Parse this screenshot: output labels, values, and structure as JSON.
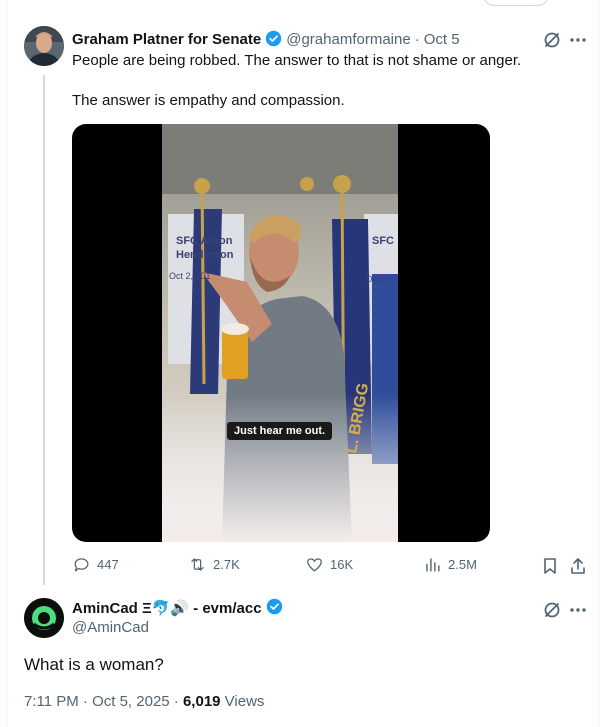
{
  "tweet": {
    "author_name": "Graham Platner for Senate",
    "handle": "@grahamformaine",
    "separator": "·",
    "date": "Oct 5",
    "line1": "People are being robbed. The answer to that is not shame or anger.",
    "line2": "The answer is empathy and compassion.",
    "video_caption": "Just hear me out.",
    "banner_left": {
      "line1": "SFC Aaron",
      "line2": "Henderson",
      "line3": "Oct 2, 201"
    },
    "banner_right": {
      "line1": "SFC",
      "line3": "Dece"
    },
    "flag_text": "L. BRIGG",
    "actions": {
      "replies": "447",
      "reposts": "2.7K",
      "likes": "16K",
      "views": "2.5M"
    }
  },
  "reply": {
    "author_name": "AminCad Ξ🐬🔊 - evm/acc",
    "handle": "@AminCad",
    "text": "What is a woman?",
    "timestamp": "7:11 PM · Oct 5, 2025 · ",
    "views_count": "6,019",
    "views_label": " Views"
  },
  "colors": {
    "accent": "#1d9bf0",
    "muted": "#536471",
    "border": "#eff3f4"
  },
  "icons": [
    "grok-icon",
    "more-icon",
    "reply-icon",
    "repost-icon",
    "like-icon",
    "views-icon",
    "bookmark-icon",
    "share-icon",
    "verified-icon"
  ]
}
